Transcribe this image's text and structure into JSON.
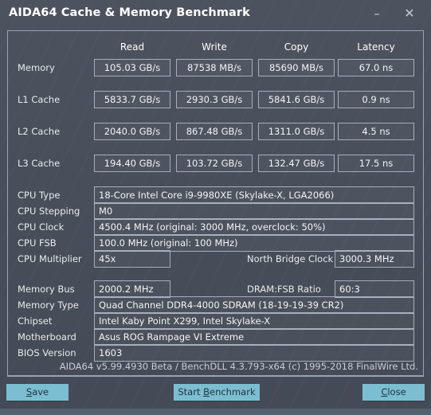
{
  "window": {
    "title": "AIDA64 Cache & Memory Benchmark",
    "minimize_icon": "minimize-icon",
    "minimize_glyph": "–",
    "close_icon": "close-icon",
    "close_glyph": "✕"
  },
  "benchmark": {
    "columns": [
      "Read",
      "Write",
      "Copy",
      "Latency"
    ],
    "rows": [
      {
        "label": "Memory",
        "read": "105.03 GB/s",
        "write": "87538 MB/s",
        "copy": "85690 MB/s",
        "latency": "67.0 ns"
      },
      {
        "label": "L1 Cache",
        "read": "5833.7 GB/s",
        "write": "2930.3 GB/s",
        "copy": "5841.6 GB/s",
        "latency": "0.9 ns"
      },
      {
        "label": "L2 Cache",
        "read": "2040.0 GB/s",
        "write": "867.48 GB/s",
        "copy": "1311.0 GB/s",
        "latency": "4.5 ns"
      },
      {
        "label": "L3 Cache",
        "read": "194.40 GB/s",
        "write": "103.72 GB/s",
        "copy": "132.47 GB/s",
        "latency": "17.5 ns"
      }
    ]
  },
  "cpu": {
    "type_label": "CPU Type",
    "type_value": "18-Core Intel Core i9-9980XE  (Skylake-X, LGA2066)",
    "stepping_label": "CPU Stepping",
    "stepping_value": "M0",
    "clock_label": "CPU Clock",
    "clock_value": "4500.4 MHz  (original: 3000 MHz, overclock: 50%)",
    "fsb_label": "CPU FSB",
    "fsb_value": "100.0 MHz  (original: 100 MHz)",
    "multiplier_label": "CPU Multiplier",
    "multiplier_value": "45x",
    "north_bridge_label": "North Bridge Clock",
    "north_bridge_value": "3000.3 MHz"
  },
  "memory": {
    "bus_label": "Memory Bus",
    "bus_value": "2000.2 MHz",
    "dram_fsb_label": "DRAM:FSB Ratio",
    "dram_fsb_value": "60:3",
    "type_label": "Memory Type",
    "type_value": "Quad Channel DDR4-4000 SDRAM  (18-19-19-39 CR2)",
    "chipset_label": "Chipset",
    "chipset_value": "Intel Kaby Point X299, Intel Skylake-X",
    "motherboard_label": "Motherboard",
    "motherboard_value": "Asus ROG Rampage VI Extreme",
    "bios_label": "BIOS Version",
    "bios_value": "1603"
  },
  "footer": {
    "copyright": "AIDA64 v5.99.4930 Beta / BenchDLL 4.3.793-x64  (c) 1995-2018 FinalWire Ltd."
  },
  "buttons": {
    "save": {
      "pre": "",
      "accel": "S",
      "post": "ave"
    },
    "start_benchmark": {
      "pre": "Start ",
      "accel": "B",
      "post": "enchmark"
    },
    "close": {
      "pre": "",
      "accel": "C",
      "post": "lose"
    }
  },
  "colors": {
    "window_bg": "#474d59",
    "button_bg": "#7cbed1",
    "border": "#9aa3b0",
    "text": "#f2f4f7",
    "statusbar": "#53606e"
  }
}
